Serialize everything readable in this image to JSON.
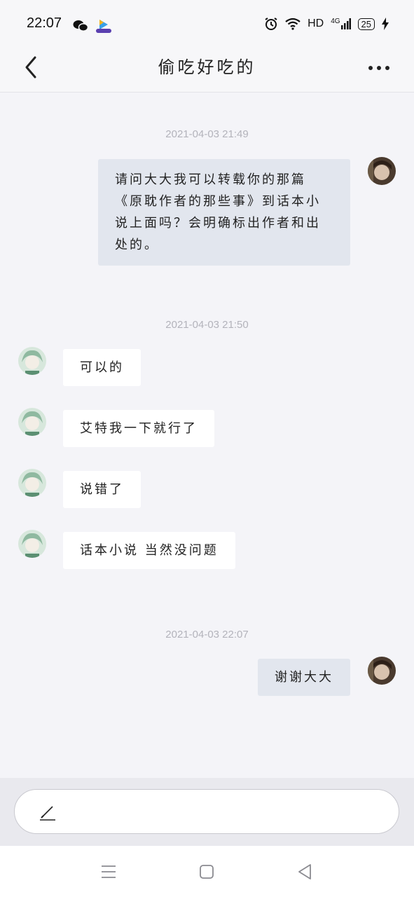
{
  "status_bar": {
    "time": "22:07",
    "network": "HD",
    "signal": "4G",
    "battery": "25",
    "icons": [
      "wechat-icon",
      "video-app-icon",
      "alarm-icon",
      "wifi-icon",
      "signal-icon",
      "battery-icon",
      "charging-icon"
    ]
  },
  "header": {
    "title": "偷吃好吃的"
  },
  "messages": [
    {
      "timestamp": "2021-04-03 21:49"
    },
    {
      "side": "right",
      "text": "请问大大我可以转载你的那篇《原耽作者的那些事》到话本小说上面吗？会明确标出作者和出处的。"
    },
    {
      "timestamp": "2021-04-03 21:50"
    },
    {
      "side": "left",
      "text": "可以的"
    },
    {
      "side": "left",
      "text": "艾特我一下就行了"
    },
    {
      "side": "left",
      "text": "说错了"
    },
    {
      "side": "left",
      "text": "话本小说 当然没问题"
    },
    {
      "timestamp": "2021-04-03 22:07"
    },
    {
      "side": "right",
      "text": "谢谢大大"
    }
  ],
  "colors": {
    "background": "#f4f4f8",
    "bubble_mine": "#e2e6ee",
    "bubble_theirs": "#ffffff",
    "timestamp": "#b3b3bb"
  }
}
